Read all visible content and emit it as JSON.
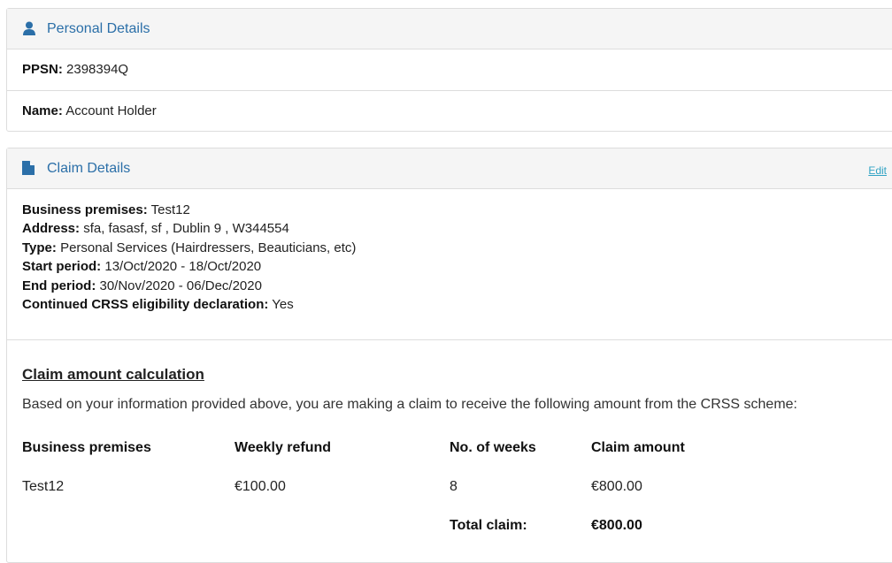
{
  "personal_details": {
    "title": "Personal Details",
    "icon": "user-icon",
    "ppsn_label": "PPSN:",
    "ppsn_value": "2398394Q",
    "name_label": "Name:",
    "name_value": "Account Holder"
  },
  "claim_details": {
    "title": "Claim Details",
    "icon": "document-icon",
    "edit_label": "Edit",
    "fields": [
      {
        "label": "Business premises:",
        "value": "Test12"
      },
      {
        "label": "Address:",
        "value": "sfa, fasasf, sf , Dublin 9 , W344554"
      },
      {
        "label": "Type:",
        "value": "Personal Services (Hairdressers, Beauticians, etc)"
      },
      {
        "label": "Start period:",
        "value": "13/Oct/2020 - 18/Oct/2020"
      },
      {
        "label": "End period:",
        "value": "30/Nov/2020 - 06/Dec/2020"
      },
      {
        "label": "Continued CRSS eligibility declaration:",
        "value": "Yes"
      }
    ]
  },
  "calculation": {
    "title": "Claim amount calculation",
    "intro": "Based on your information provided above, you are making a claim to receive the following amount from the CRSS scheme:",
    "headers": [
      "Business premises",
      "Weekly refund",
      "No. of weeks",
      "Claim amount"
    ],
    "rows": [
      [
        "Test12",
        "€100.00",
        "8",
        "€800.00"
      ]
    ],
    "total_label": "Total claim:",
    "total_value": "€800.00"
  },
  "colors": {
    "heading_text": "#2b6fa8",
    "edit_link": "#31a3c4",
    "heading_bg": "#f5f5f5",
    "border": "#dddddd"
  }
}
